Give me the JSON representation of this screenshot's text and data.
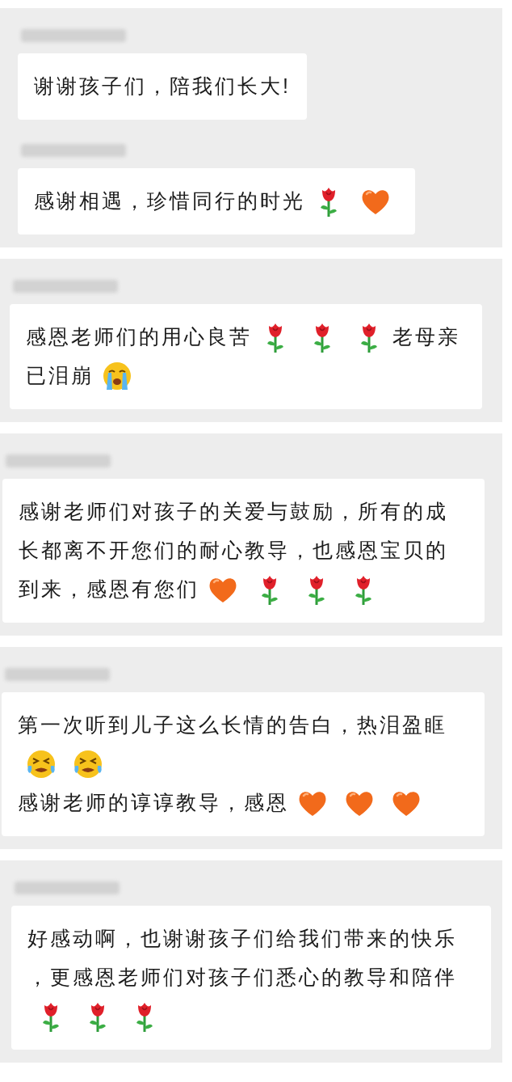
{
  "threads": [
    {
      "comments": [
        {
          "name_blurred": true,
          "lines": [
            [
              {
                "kind": "text",
                "text": "谢谢孩子们，陪我们长大!"
              }
            ]
          ]
        },
        {
          "name_blurred": true,
          "lines": [
            [
              {
                "kind": "text",
                "text": "感谢相遇，珍惜同行的时光"
              },
              {
                "kind": "rose"
              },
              {
                "kind": "heart"
              }
            ]
          ]
        }
      ]
    },
    {
      "comments": [
        {
          "name_blurred": true,
          "lines": [
            [
              {
                "kind": "text",
                "text": "感恩老师们的用心良苦"
              },
              {
                "kind": "rose"
              },
              {
                "kind": "rose"
              },
              {
                "kind": "rose"
              },
              {
                "kind": "text",
                "text": "老母亲"
              }
            ],
            [
              {
                "kind": "text",
                "text": "已泪崩"
              },
              {
                "kind": "crying"
              }
            ]
          ]
        }
      ]
    },
    {
      "comments": [
        {
          "name_blurred": true,
          "lines": [
            [
              {
                "kind": "text",
                "text": "感谢老师们对孩子的关爱与鼓励，所有的成"
              }
            ],
            [
              {
                "kind": "text",
                "text": "长都离不开您们的耐心教导，也感恩宝贝的"
              }
            ],
            [
              {
                "kind": "text",
                "text": "到来，感恩有您们"
              },
              {
                "kind": "heart"
              },
              {
                "kind": "rose"
              },
              {
                "kind": "rose"
              },
              {
                "kind": "rose"
              }
            ]
          ]
        }
      ]
    },
    {
      "comments": [
        {
          "name_blurred": true,
          "lines": [
            [
              {
                "kind": "text",
                "text": "第一次听到儿子这么长情的告白，热泪盈眶"
              }
            ],
            [
              {
                "kind": "sobbing"
              },
              {
                "kind": "sobbing"
              }
            ],
            [
              {
                "kind": "text",
                "text": "感谢老师的谆谆教导，感恩"
              },
              {
                "kind": "heart"
              },
              {
                "kind": "heart"
              },
              {
                "kind": "heart"
              }
            ]
          ]
        }
      ]
    },
    {
      "comments": [
        {
          "name_blurred": true,
          "lines": [
            [
              {
                "kind": "text",
                "text": "好感动啊，也谢谢孩子们给我们带来的快乐"
              }
            ],
            [
              {
                "kind": "text",
                "text": "，更感恩老师们对孩子们悉心的教导和陪伴"
              }
            ],
            [
              {
                "kind": "rose"
              },
              {
                "kind": "rose"
              },
              {
                "kind": "rose"
              }
            ]
          ]
        }
      ]
    }
  ]
}
